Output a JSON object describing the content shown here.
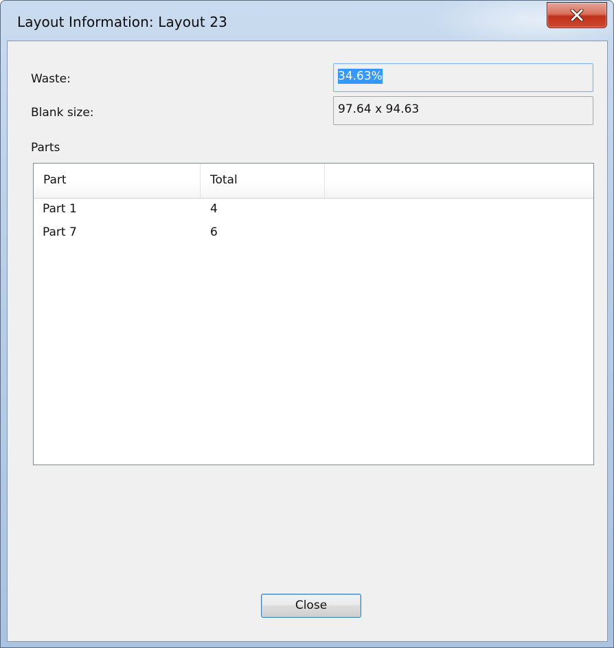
{
  "window": {
    "title": "Layout Information: Layout 23",
    "close_glyph": "close-icon"
  },
  "waste": {
    "label": "Waste:",
    "value": "34.63%"
  },
  "blank_size": {
    "label": "Blank size:",
    "value": "97.64 x 94.63"
  },
  "parts": {
    "label": "Parts",
    "columns": [
      "Part",
      "Total",
      ""
    ],
    "rows": [
      {
        "part": "Part 1",
        "total": "4"
      },
      {
        "part": "Part 7",
        "total": "6"
      }
    ]
  },
  "footer": {
    "close_label": "Close"
  },
  "colors": {
    "selection": "#3399ff",
    "close_button_red": "#c0301a"
  }
}
